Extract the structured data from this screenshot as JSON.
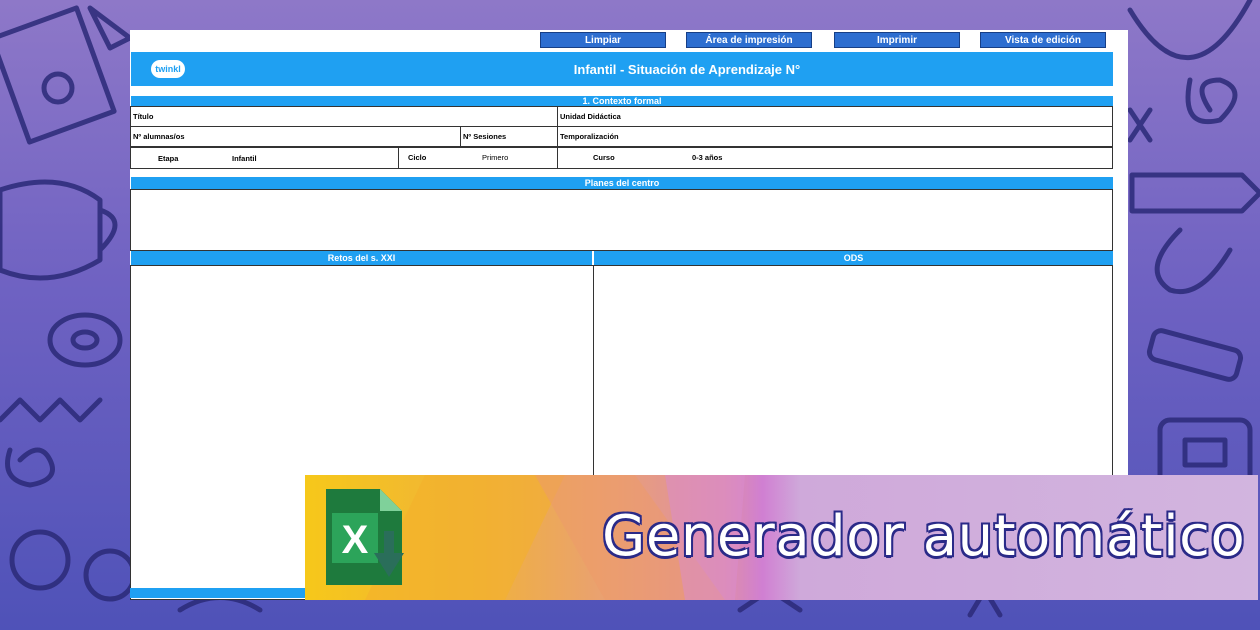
{
  "toolbar": {
    "buttons": [
      "Limpiar",
      "Área de impresión",
      "Imprimir",
      "Vista de edición"
    ]
  },
  "header": {
    "logo_text": "twinkl",
    "title": "Infantil - Situación de Aprendizaje N°"
  },
  "sections": {
    "contexto": {
      "title": "1. Contexto formal",
      "titulo_label": "Título",
      "unidad_label": "Unidad Didáctica",
      "alumnos_label": "Nº alumnas/os",
      "sesiones_label": "Nº Sesiones",
      "temporalizacion_label": "Temporalización",
      "etapa_label": "Etapa",
      "etapa_value": "Infantil",
      "ciclo_label": "Ciclo",
      "ciclo_value": "Primero",
      "curso_label": "Curso",
      "curso_value": "0-3 años"
    },
    "planes": {
      "title": "Planes del centro"
    },
    "retos": {
      "title": "Retos del s. XXI"
    },
    "ods": {
      "title": "ODS"
    }
  },
  "banner": {
    "text": "Generador automático",
    "icon": "excel-download-icon"
  },
  "colors": {
    "accent": "#1fa0f2",
    "button": "#2d6ed0",
    "background": "#6f62c2",
    "excel_green": "#1e7a3d"
  }
}
